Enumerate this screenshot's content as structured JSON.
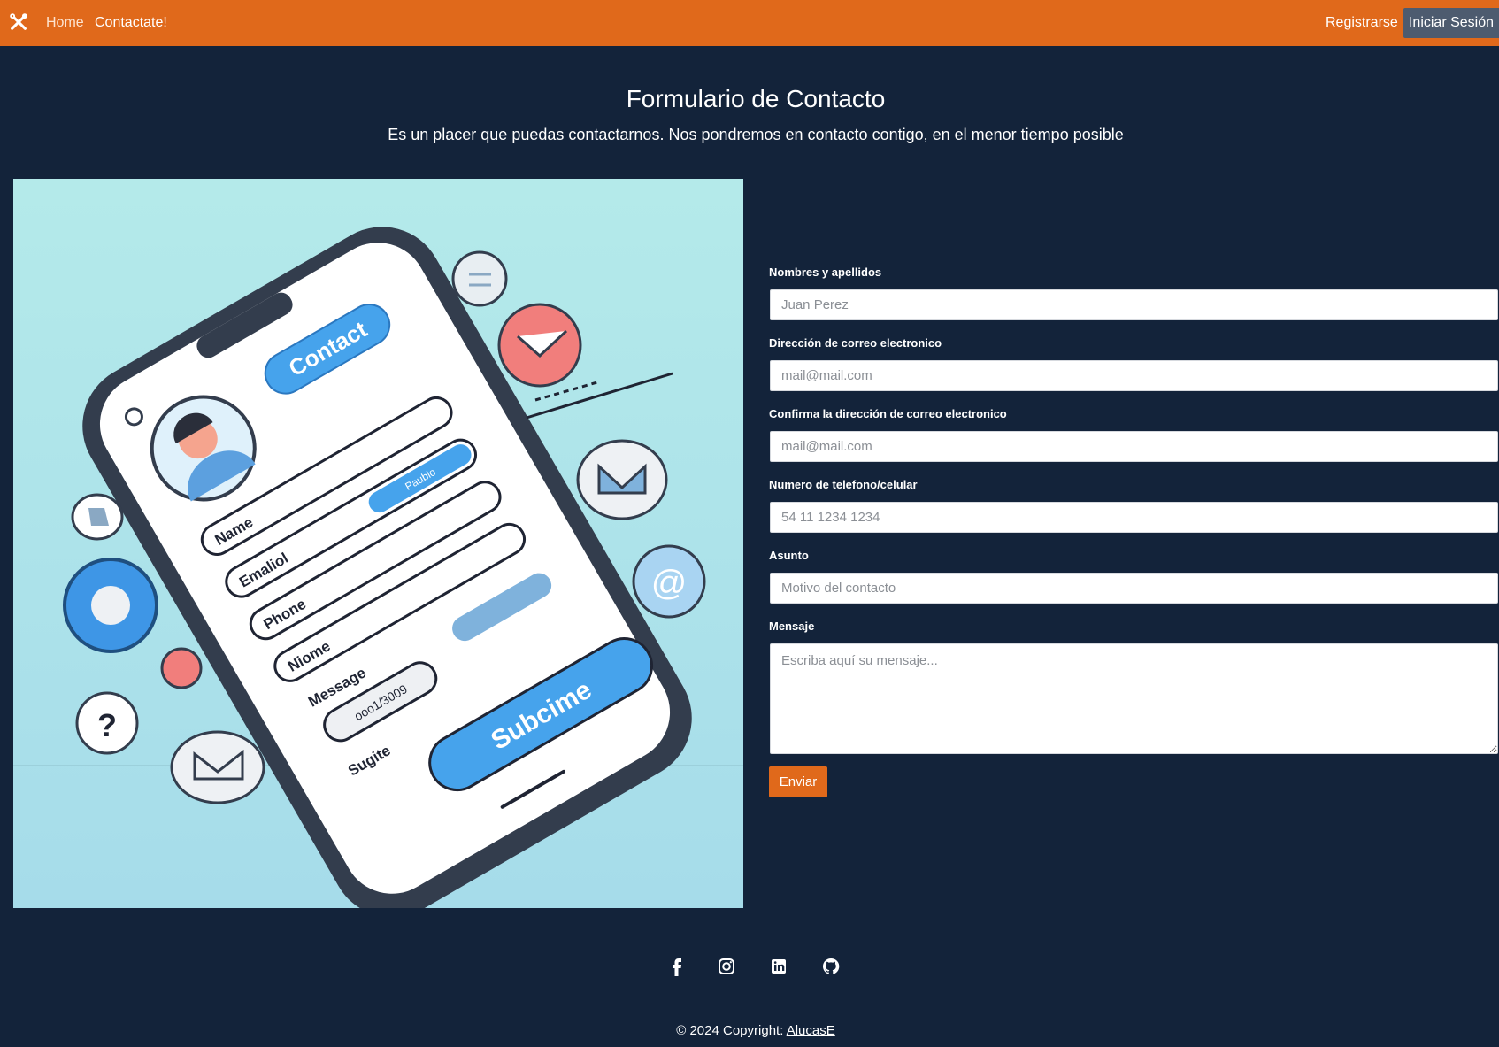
{
  "navbar": {
    "home_label": "Home",
    "contact_label": "Contactate!",
    "register_label": "Registrarse",
    "login_label": "Iniciar Sesión",
    "brand_icon": "tools-icon",
    "bg_color": "#e0691b"
  },
  "page": {
    "title": "Formulario de Contacto",
    "subtitle": "Es un placer que puedas contactarnos. Nos pondremos en contacto contigo, en el menor tiempo posible"
  },
  "illustration": {
    "contact_label": "Contact",
    "field_labels": [
      "Name",
      "Emaliol",
      "Phone",
      "Niome",
      "Message",
      "Sugite"
    ],
    "pill_text": "ooo1/3009",
    "small_pill_text": "Paublo",
    "button_label": "Subcime"
  },
  "form": {
    "name_label": "Nombres y apellidos",
    "name_placeholder": "Juan Perez",
    "email_label": "Dirección de correo electronico",
    "email_placeholder": "mail@mail.com",
    "email_confirm_label": "Confirma la dirección de correo electronico",
    "email_confirm_placeholder": "mail@mail.com",
    "phone_label": "Numero de telefono/celular",
    "phone_placeholder": "54 11 1234 1234",
    "subject_label": "Asunto",
    "subject_placeholder": "Motivo del contacto",
    "message_label": "Mensaje",
    "message_placeholder": "Escriba aquí su mensaje...",
    "submit_label": "Enviar"
  },
  "footer": {
    "social_icons": [
      "facebook-icon",
      "instagram-icon",
      "linkedin-icon",
      "github-icon"
    ],
    "copyright_prefix": "© 2024 Copyright: ",
    "copyright_link": "AlucasE"
  },
  "colors": {
    "background": "#13233a",
    "accent": "#e0691b",
    "login_button": "#4d5b6f"
  }
}
